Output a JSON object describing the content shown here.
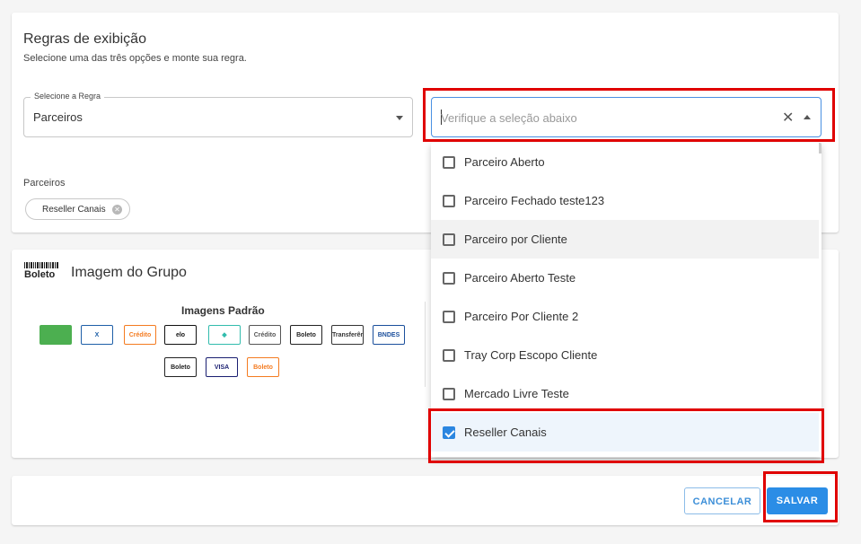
{
  "rules": {
    "title": "Regras de exibição",
    "subtitle": "Selecione uma das três opções e monte sua regra.",
    "select_legend": "Selecione a Regra",
    "select_value": "Parceiros",
    "partners_label": "Parceiros",
    "chip_label": "Reseller Canais"
  },
  "combo": {
    "placeholder": "Verifique a seleção abaixo",
    "options": [
      {
        "label": "Parceiro Aberto",
        "checked": false
      },
      {
        "label": "Parceiro Fechado teste123",
        "checked": false
      },
      {
        "label": "Parceiro por Cliente",
        "checked": false
      },
      {
        "label": "Parceiro Aberto Teste",
        "checked": false
      },
      {
        "label": "Parceiro Por Cliente 2",
        "checked": false
      },
      {
        "label": "Tray Corp Escopo Cliente",
        "checked": false
      },
      {
        "label": "Mercado Livre Teste",
        "checked": false
      },
      {
        "label": "Reseller Canais",
        "checked": true
      }
    ]
  },
  "image_group": {
    "title": "Imagem do Grupo",
    "icon_text": "Boleto",
    "default_images_title": "Imagens Padrão",
    "payment_icons": [
      {
        "name": "money-icon",
        "text": "",
        "color": "#4caf50"
      },
      {
        "name": "caixa-icon",
        "text": "X",
        "color": "#1e5fa8"
      },
      {
        "name": "credito-orange-icon",
        "text": "Crédito",
        "color": "#f47b20"
      },
      {
        "name": "elo-hipercard-icon",
        "text": "elo",
        "color": "#111111"
      },
      {
        "name": "pix-icon",
        "text": "◆",
        "color": "#32bcad"
      },
      {
        "name": "credito-gray-icon",
        "text": "Crédito",
        "color": "#555555"
      },
      {
        "name": "boleto-icon",
        "text": "Boleto",
        "color": "#222222"
      },
      {
        "name": "transferencia-icon",
        "text": "Transferência Bancária",
        "color": "#333333"
      },
      {
        "name": "bndes-icon",
        "text": "BNDES",
        "color": "#1b4f9c"
      },
      {
        "name": "boleto-dark-icon",
        "text": "Boleto",
        "color": "#222222"
      },
      {
        "name": "visa-mastercard-icon",
        "text": "VISA",
        "color": "#1a1f71"
      },
      {
        "name": "boleto-orange-icon",
        "text": "Boleto",
        "color": "#f47b20"
      }
    ]
  },
  "actions": {
    "cancel_label": "CANCELAR",
    "save_label": "SALVAR"
  },
  "colors": {
    "accent": "#2b8de6",
    "highlight_border": "#e00000"
  }
}
